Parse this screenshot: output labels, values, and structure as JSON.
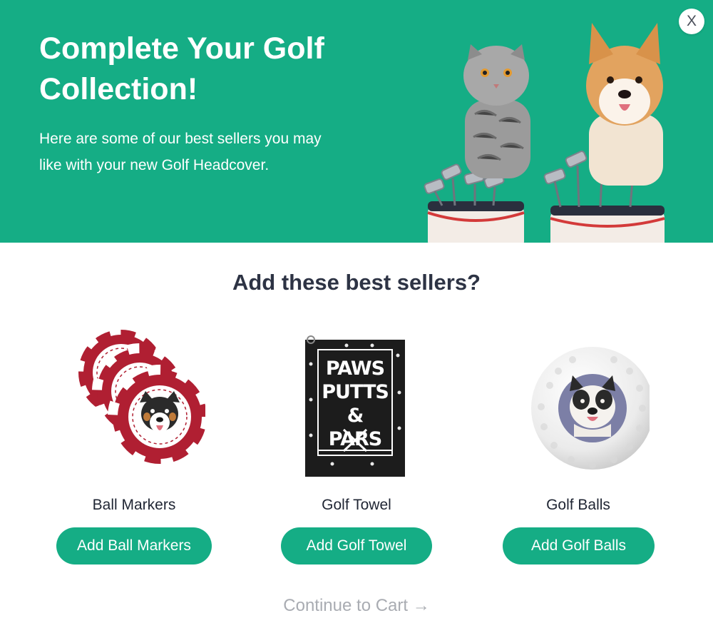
{
  "hero": {
    "title": "Complete Your Golf Collection!",
    "subtitle": "Here are some of our best sellers you may like with your new Golf Headcover.",
    "close_label": "X"
  },
  "section_title": "Add these best sellers?",
  "products": [
    {
      "name": "Ball Markers",
      "button_label": "Add Ball Markers",
      "image": "ball-markers-image"
    },
    {
      "name": "Golf Towel",
      "button_label": "Add Golf Towel",
      "image": "golf-towel-image"
    },
    {
      "name": "Golf Balls",
      "button_label": "Add Golf Balls",
      "image": "golf-ball-image"
    }
  ],
  "towel": {
    "line1": "PAWS",
    "line2": "PUTTS",
    "line3": "& PARS"
  },
  "continue_label": "Continue to Cart →",
  "colors": {
    "brand_green": "#15ad85",
    "heading": "#2d3344",
    "muted_link": "#a9acb2",
    "chip_red": "#b01f32"
  }
}
